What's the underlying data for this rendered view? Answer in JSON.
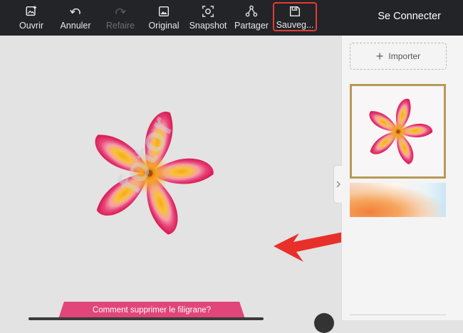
{
  "toolbar": {
    "items": [
      {
        "label": "Ouvrir",
        "icon": "image-add-icon",
        "enabled": true
      },
      {
        "label": "Annuler",
        "icon": "undo-icon",
        "enabled": true
      },
      {
        "label": "Refaire",
        "icon": "redo-icon",
        "enabled": false
      },
      {
        "label": "Original",
        "icon": "image-icon",
        "enabled": true
      },
      {
        "label": "Snapshot",
        "icon": "snapshot-icon",
        "enabled": true
      },
      {
        "label": "Partager",
        "icon": "share-icon",
        "enabled": true
      },
      {
        "label": "Sauveg...",
        "icon": "save-icon",
        "enabled": true,
        "highlighted": true
      }
    ],
    "connect_label": "Se Connecter"
  },
  "canvas": {
    "watermark": "fotor"
  },
  "sidebar": {
    "import_label": "Importer"
  },
  "banner": {
    "text": "Comment supprimer le filigrane?"
  },
  "colors": {
    "toolbar_bg": "#222427",
    "highlight": "#e53a36",
    "banner": "#e1457a",
    "selected_thumb_border": "#b89a56"
  }
}
